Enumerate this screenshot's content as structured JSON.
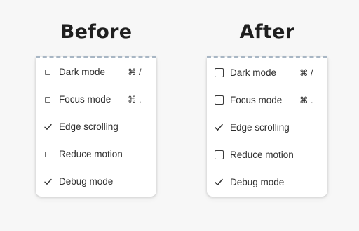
{
  "headings": {
    "before": "Before",
    "after": "After"
  },
  "menus": {
    "before": [
      {
        "label": "Dark mode",
        "checked": false,
        "shortcut": "⌘  /"
      },
      {
        "label": "Focus mode",
        "checked": false,
        "shortcut": "⌘  ."
      },
      {
        "label": "Edge scrolling",
        "checked": true,
        "shortcut": ""
      },
      {
        "label": "Reduce motion",
        "checked": false,
        "shortcut": ""
      },
      {
        "label": "Debug mode",
        "checked": true,
        "shortcut": ""
      }
    ],
    "after": [
      {
        "label": "Dark mode",
        "checked": false,
        "shortcut": "⌘  /"
      },
      {
        "label": "Focus mode",
        "checked": false,
        "shortcut": "⌘  ."
      },
      {
        "label": "Edge scrolling",
        "checked": true,
        "shortcut": ""
      },
      {
        "label": "Reduce motion",
        "checked": false,
        "shortcut": ""
      },
      {
        "label": "Debug mode",
        "checked": true,
        "shortcut": ""
      }
    ]
  },
  "colors": {
    "background": "#f7f7f7",
    "menu": "#ffffff",
    "dashed_edge": "#a8b6c4",
    "text": "#2e2e2e"
  }
}
